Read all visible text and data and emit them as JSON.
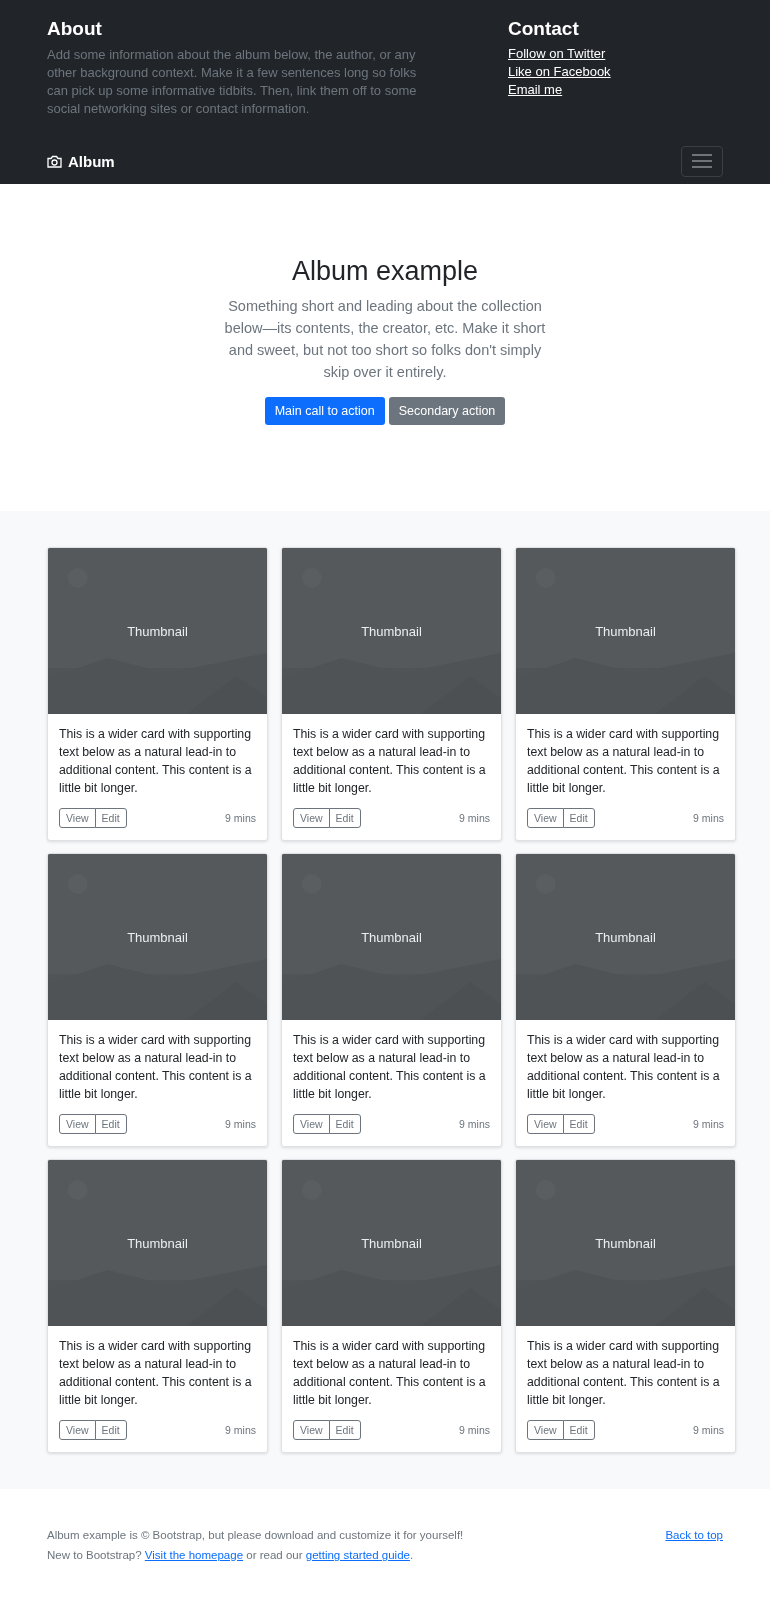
{
  "header": {
    "about": {
      "title": "About",
      "text": "Add some information about the album below, the author, or any other background context. Make it a few sentences long so folks can pick up some informative tidbits. Then, link them off to some social networking sites or contact information."
    },
    "contact": {
      "title": "Contact",
      "links": [
        "Follow on Twitter",
        "Like on Facebook",
        "Email me"
      ]
    }
  },
  "navbar": {
    "brand": "Album"
  },
  "hero": {
    "title": "Album example",
    "lead": "Something short and leading about the collection below—its contents, the creator, etc. Make it short and sweet, but not too short so folks don't simply skip over it entirely.",
    "buttons": [
      {
        "label": "Main call to action",
        "kind": "primary"
      },
      {
        "label": "Secondary action",
        "kind": "secondary"
      }
    ]
  },
  "cards": [
    {
      "thumbnail": "Thumbnail",
      "text": "This is a wider card with supporting text below as a natural lead-in to additional content. This content is a little bit longer.",
      "buttons": [
        "View",
        "Edit"
      ],
      "time": "9 mins"
    },
    {
      "thumbnail": "Thumbnail",
      "text": "This is a wider card with supporting text below as a natural lead-in to additional content. This content is a little bit longer.",
      "buttons": [
        "View",
        "Edit"
      ],
      "time": "9 mins"
    },
    {
      "thumbnail": "Thumbnail",
      "text": "This is a wider card with supporting text below as a natural lead-in to additional content. This content is a little bit longer.",
      "buttons": [
        "View",
        "Edit"
      ],
      "time": "9 mins"
    },
    {
      "thumbnail": "Thumbnail",
      "text": "This is a wider card with supporting text below as a natural lead-in to additional content. This content is a little bit longer.",
      "buttons": [
        "View",
        "Edit"
      ],
      "time": "9 mins"
    },
    {
      "thumbnail": "Thumbnail",
      "text": "This is a wider card with supporting text below as a natural lead-in to additional content. This content is a little bit longer.",
      "buttons": [
        "View",
        "Edit"
      ],
      "time": "9 mins"
    },
    {
      "thumbnail": "Thumbnail",
      "text": "This is a wider card with supporting text below as a natural lead-in to additional content. This content is a little bit longer.",
      "buttons": [
        "View",
        "Edit"
      ],
      "time": "9 mins"
    },
    {
      "thumbnail": "Thumbnail",
      "text": "This is a wider card with supporting text below as a natural lead-in to additional content. This content is a little bit longer.",
      "buttons": [
        "View",
        "Edit"
      ],
      "time": "9 mins"
    },
    {
      "thumbnail": "Thumbnail",
      "text": "This is a wider card with supporting text below as a natural lead-in to additional content. This content is a little bit longer.",
      "buttons": [
        "View",
        "Edit"
      ],
      "time": "9 mins"
    },
    {
      "thumbnail": "Thumbnail",
      "text": "This is a wider card with supporting text below as a natural lead-in to additional content. This content is a little bit longer.",
      "buttons": [
        "View",
        "Edit"
      ],
      "time": "9 mins"
    }
  ],
  "footer": {
    "back_to_top": "Back to top",
    "line1": "Album example is © Bootstrap, but please download and customize it for yourself!",
    "line2": {
      "prefix": "New to Bootstrap?",
      "link1": "Visit the homepage",
      "middle": "or read our",
      "link2": "getting started guide",
      "suffix": "."
    }
  }
}
